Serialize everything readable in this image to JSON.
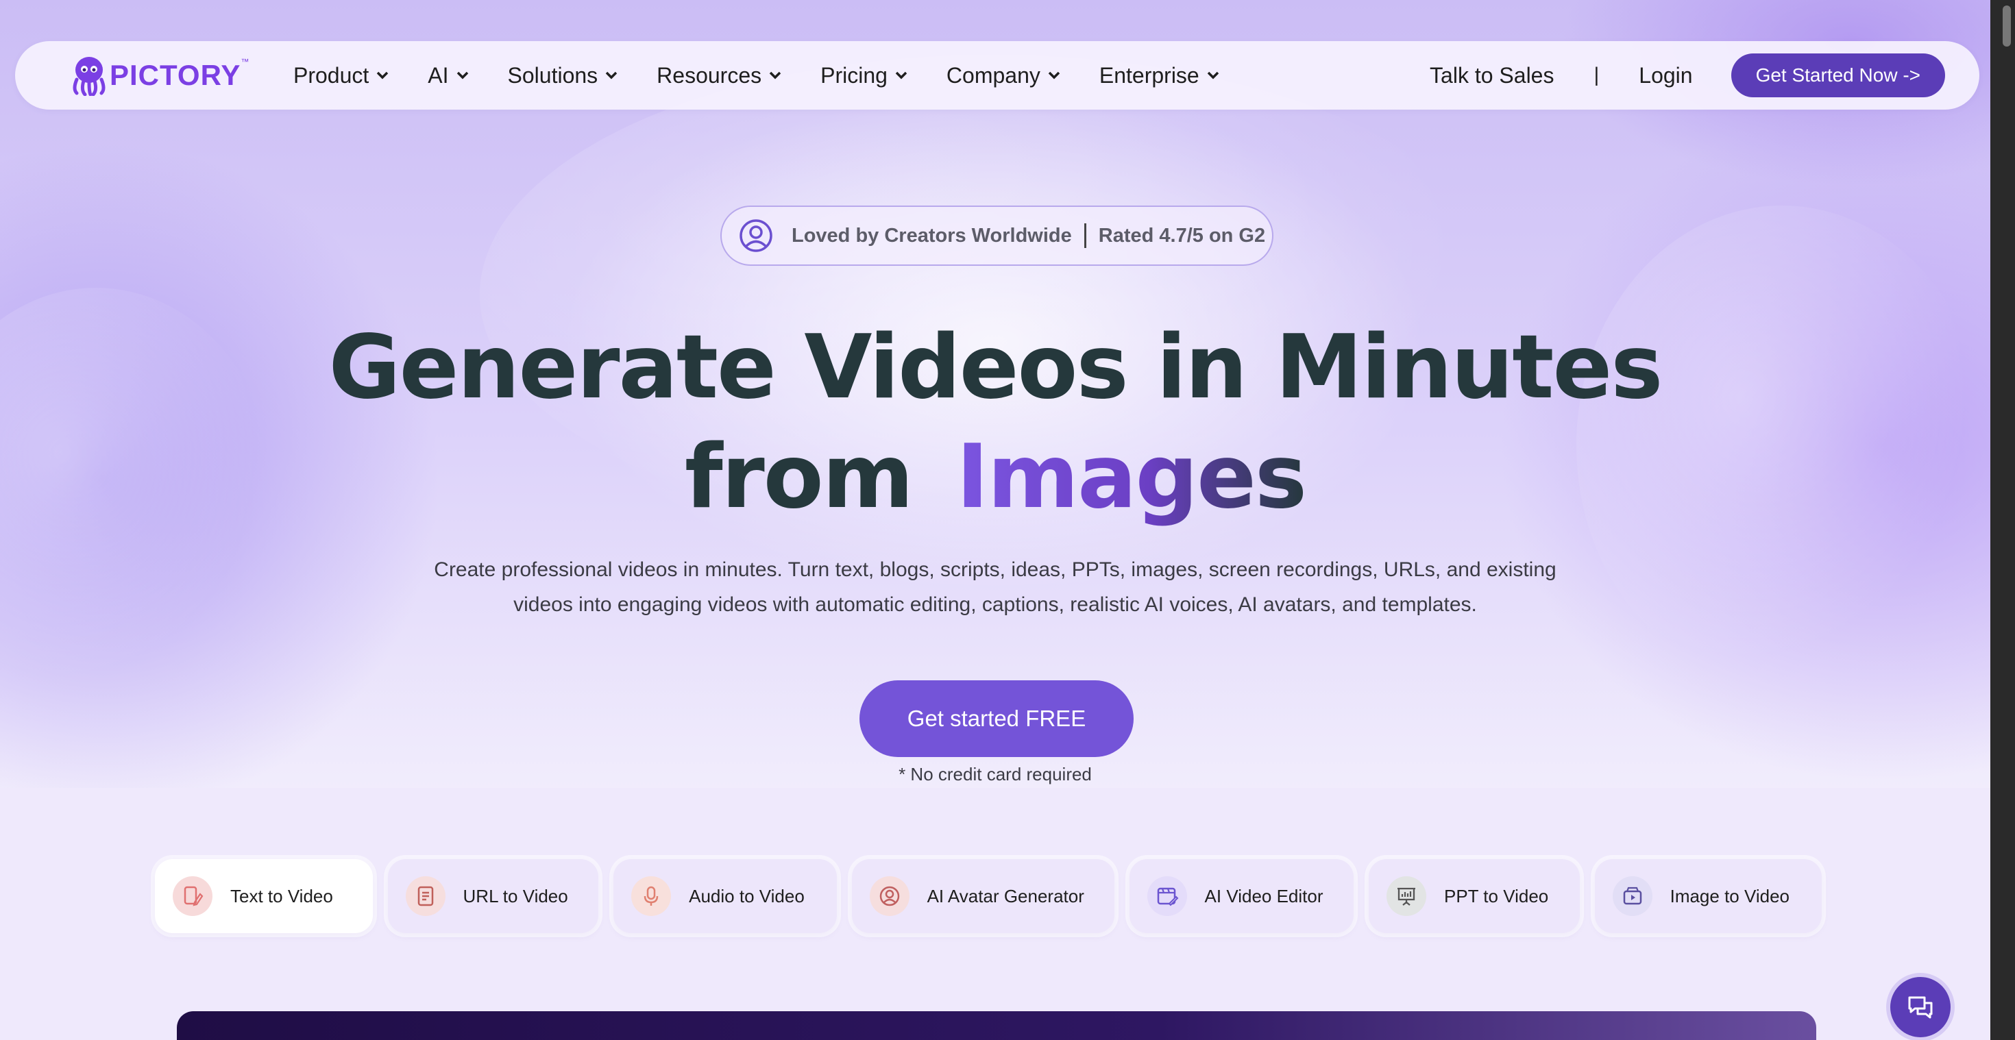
{
  "nav": {
    "logo_text": "PICTORY",
    "logo_tm": "™",
    "menu": [
      {
        "label": "Product"
      },
      {
        "label": "AI"
      },
      {
        "label": "Solutions"
      },
      {
        "label": "Resources"
      },
      {
        "label": "Pricing"
      },
      {
        "label": "Company"
      },
      {
        "label": "Enterprise"
      }
    ],
    "talk_to_sales": "Talk to Sales",
    "separator": "|",
    "login": "Login",
    "cta": "Get Started Now ->"
  },
  "badge": {
    "loved": "Loved by Creators Worldwide",
    "rated": "Rated 4.7/5 on G2"
  },
  "hero": {
    "line1": "Generate Videos in Minutes",
    "line2_prefix": "from",
    "line2_accent": "Images",
    "subtext": "Create professional videos in minutes. Turn text, blogs, scripts, ideas, PPTs, images, screen recordings, URLs, and existing videos into engaging videos with automatic editing, captions, realistic AI voices, AI avatars, and templates.",
    "cta": "Get started FREE",
    "note": "* No credit card required"
  },
  "tabs": [
    {
      "label": "Text to Video",
      "icon": "text-video-icon",
      "active": true
    },
    {
      "label": "URL to Video",
      "icon": "url-doc-icon"
    },
    {
      "label": "Audio to Video",
      "icon": "microphone-icon"
    },
    {
      "label": "AI Avatar Generator",
      "icon": "avatar-icon"
    },
    {
      "label": "AI Video Editor",
      "icon": "video-editor-icon"
    },
    {
      "label": "PPT to Video",
      "icon": "presentation-icon"
    },
    {
      "label": "Image to Video",
      "icon": "image-video-icon"
    }
  ],
  "colors": {
    "brand": "#7b3fe4",
    "nav_cta": "#5b3db7",
    "hero_cta": "#7454d8",
    "headline": "#25383c"
  },
  "chat": {
    "icon": "chat-icon"
  }
}
